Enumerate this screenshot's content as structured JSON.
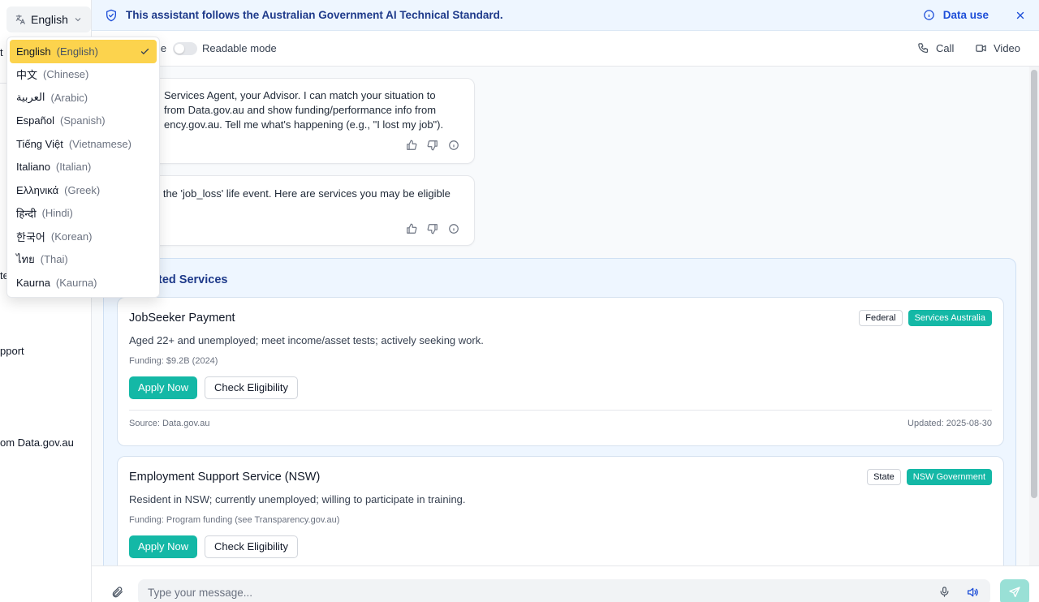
{
  "sidebar": {
    "language_button": "English",
    "fragments": [
      "t",
      "te",
      "pport",
      "om Data.gov.au"
    ]
  },
  "language_menu": {
    "options": [
      {
        "native": "English",
        "english": "(English)",
        "selected": true
      },
      {
        "native": "中文",
        "english": "(Chinese)"
      },
      {
        "native": "العربية",
        "english": "(Arabic)"
      },
      {
        "native": "Español",
        "english": "(Spanish)"
      },
      {
        "native": "Tiếng Việt",
        "english": "(Vietnamese)"
      },
      {
        "native": "Italiano",
        "english": "(Italian)"
      },
      {
        "native": "Ελληνικά",
        "english": "(Greek)"
      },
      {
        "native": "हिन्दी",
        "english": "(Hindi)"
      },
      {
        "native": "한국어",
        "english": "(Korean)"
      },
      {
        "native": "ไทย",
        "english": "(Thai)"
      },
      {
        "native": "Kaurna",
        "english": "(Kaurna)"
      }
    ]
  },
  "banner": {
    "text": "This assistant follows the Australian Government AI Technical Standard.",
    "data_use": "Data use"
  },
  "toolbar": {
    "toggle_fragment": "le",
    "readable_mode": "Readable mode",
    "call": "Call",
    "video": "Video"
  },
  "messages": [
    {
      "text": "Services Agent, your Advisor. I can match your situation to\nfrom Data.gov.au and show funding/performance info from\nency.gov.au. Tell me what's happening (e.g., \"I lost my job\")."
    },
    {
      "text": "d the 'job_loss' life event. Here are services you may be eligible"
    }
  ],
  "services": {
    "title": "ted Services",
    "cards": [
      {
        "title": "JobSeeker Payment",
        "tag_level": "Federal",
        "tag_agency": "Services Australia",
        "description": "Aged 22+ and unemployed; meet income/asset tests; actively seeking work.",
        "funding": "Funding: $9.2B (2024)",
        "apply": "Apply Now",
        "check": "Check Eligibility",
        "source": "Source: Data.gov.au",
        "updated": "Updated: 2025-08-30"
      },
      {
        "title": "Employment Support Service (NSW)",
        "tag_level": "State",
        "tag_agency": "NSW Government",
        "description": "Resident in NSW; currently unemployed; willing to participate in training.",
        "funding": "Funding: Program funding (see Transparency.gov.au)",
        "apply": "Apply Now",
        "check": "Check Eligibility"
      }
    ]
  },
  "input": {
    "placeholder": "Type your message..."
  },
  "colors": {
    "accent": "#14b8a6",
    "selected": "#fcd34d",
    "banner": "#eef6ff"
  }
}
